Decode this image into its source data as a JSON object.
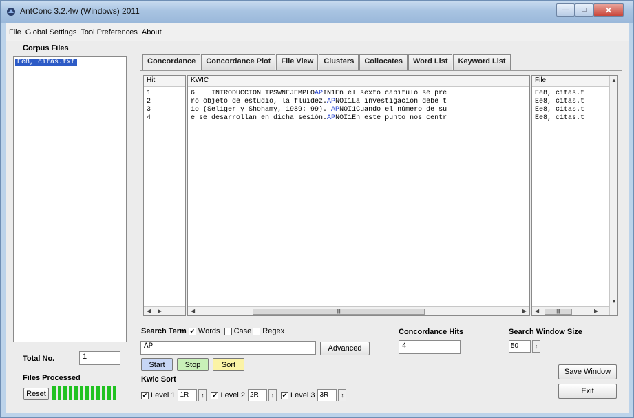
{
  "window": {
    "title": "AntConc 3.2.4w (Windows) 2011"
  },
  "menu": [
    "File",
    "Global Settings",
    "Tool Preferences",
    "About"
  ],
  "corpus": {
    "header": "Corpus Files",
    "files": [
      "Ee8, citas.txt"
    ],
    "total_label": "Total No.",
    "total_value": "1",
    "processed_label": "Files Processed",
    "reset_label": "Reset",
    "progress": 1.0
  },
  "tabs": [
    "Concordance",
    "Concordance Plot",
    "File View",
    "Clusters",
    "Collocates",
    "Word List",
    "Keyword List"
  ],
  "results": {
    "hit_header": "Hit",
    "kwic_header": "KWIC",
    "file_header": "File",
    "rows": [
      {
        "hit": "1",
        "pre": "6    INTRODUCCIÓN TPSWNEJEMPLO",
        "kw": "AP",
        "post": "IN1En el sexto capítulo se pre",
        "file": "Ee8, citas.t"
      },
      {
        "hit": "2",
        "pre": "ro objeto de estudio, la fluidez.",
        "kw": "AP",
        "post": "NOI1La investigación debe t",
        "file": "Ee8, citas.t"
      },
      {
        "hit": "3",
        "pre": "io (Seliger y Shohamy, 1989: 99). ",
        "kw": "AP",
        "post": "NOI1Cuando el número de su",
        "file": "Ee8, citas.t"
      },
      {
        "hit": "4",
        "pre": "e se desarrollan en dicha sesión.",
        "kw": "AP",
        "post": "NOI1En este punto nos centr",
        "file": "Ee8, citas.t"
      }
    ]
  },
  "search": {
    "label": "Search Term",
    "words_label": "Words",
    "case_label": "Case",
    "regex_label": "Regex",
    "value": "AP",
    "advanced_label": "Advanced",
    "start_label": "Start",
    "stop_label": "Stop",
    "sort_label": "Sort"
  },
  "hits": {
    "label": "Concordance Hits",
    "value": "4"
  },
  "window_size": {
    "label": "Search Window Size",
    "value": "50"
  },
  "kwic_sort": {
    "label": "Kwic Sort",
    "level1_label": "Level 1",
    "level1_value": "1R",
    "level2_label": "Level 2",
    "level2_value": "2R",
    "level3_label": "Level 3",
    "level3_value": "3R"
  },
  "save_window_label": "Save Window",
  "exit_label": "Exit",
  "colors": {
    "start_btn": "#c7d6f5",
    "stop_btn": "#c8f0b8",
    "sort_btn": "#fbf3a6",
    "progress": "#21c221",
    "keyword": "#1f3fd1"
  }
}
